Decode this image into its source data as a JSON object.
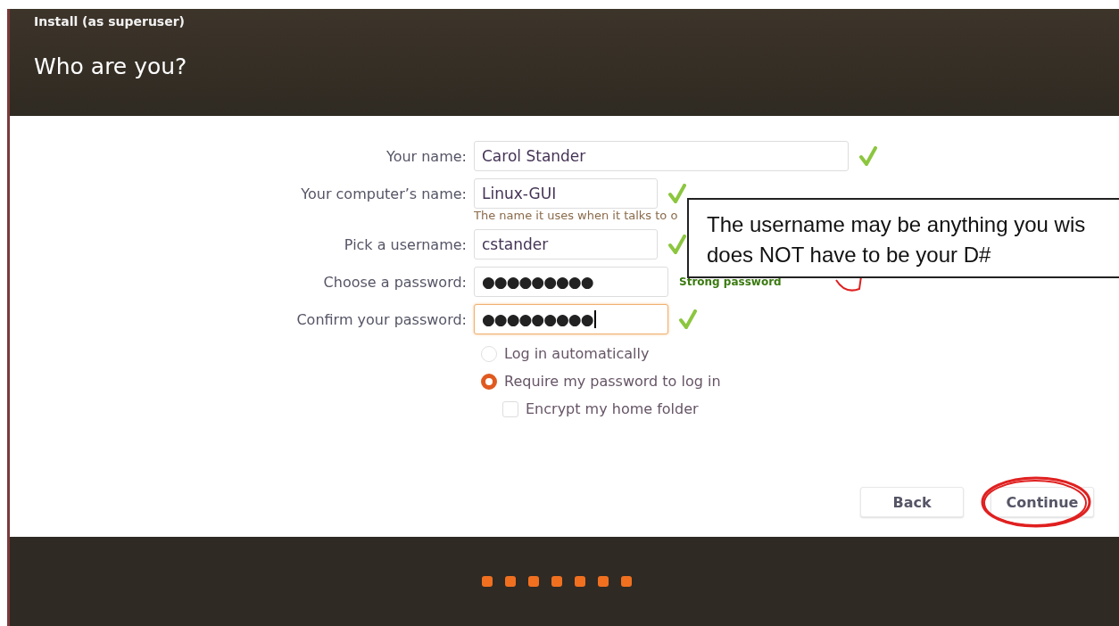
{
  "window": {
    "title": "Install (as superuser)"
  },
  "heading": "Who are you?",
  "fields": [
    {
      "label": "Your name:",
      "value": "Carol Stander",
      "valid": true,
      "focused": false,
      "kind": "text"
    },
    {
      "label": "Your computer’s name:",
      "value": "Linux-GUI",
      "valid": true,
      "focused": false,
      "kind": "text",
      "hint": "The name it uses when it talks to o"
    },
    {
      "label": "Pick a username:",
      "value": "cstander",
      "valid": true,
      "focused": false,
      "kind": "text"
    },
    {
      "label": "Choose a password:",
      "value": "●●●●●●●●●",
      "valid": false,
      "focused": false,
      "kind": "password",
      "strength": "Strong password"
    },
    {
      "label": "Confirm your password:",
      "value": "●●●●●●●●●",
      "valid": true,
      "focused": true,
      "kind": "password"
    }
  ],
  "login_options": [
    {
      "label": "Log in automatically",
      "kind": "radio",
      "selected": false
    },
    {
      "label": "Require my password to log in",
      "kind": "radio",
      "selected": true
    },
    {
      "label": "Encrypt my home folder",
      "kind": "checkbox",
      "checked": false
    }
  ],
  "buttons": [
    {
      "label": "Back",
      "circled": false
    },
    {
      "label": "Continue",
      "circled": true
    }
  ],
  "progress_steps": [
    {
      "done": true
    },
    {
      "done": true
    },
    {
      "done": true
    },
    {
      "done": true
    },
    {
      "done": true
    },
    {
      "done": true
    },
    {
      "done": true
    }
  ],
  "callout": {
    "lines": [
      "The username may be anything you wis",
      "does NOT have to be your D#"
    ]
  }
}
